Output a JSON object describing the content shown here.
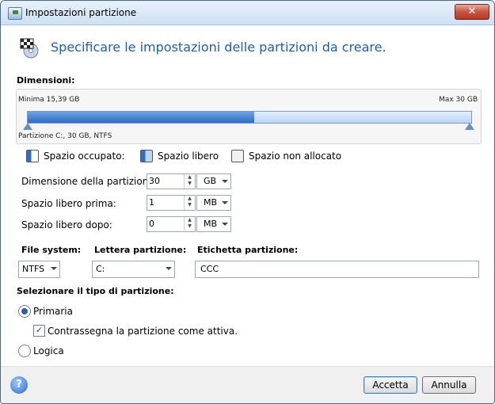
{
  "window": {
    "title": "Impostazioni partizione",
    "close_label": "✕"
  },
  "header": {
    "text": "Specificare le impostazioni delle partizioni da creare."
  },
  "sizes": {
    "label": "Dimensioni:",
    "min": "Minima 15,39 GB",
    "max": "Max 30 GB",
    "partition_info": "Partizione C:, 30 GB, NTFS",
    "used_fraction": 0.51
  },
  "legend": {
    "occupied": "Spazio occupato:",
    "free": "Spazio libero",
    "unallocated": "Spazio non allocato"
  },
  "fields": {
    "partition_size": {
      "label": "Dimensione della partizione:",
      "value": "30",
      "unit": "GB"
    },
    "free_before": {
      "label": "Spazio libero prima:",
      "value": "1",
      "unit": "MB"
    },
    "free_after": {
      "label": "Spazio libero dopo:",
      "value": "0",
      "unit": "MB"
    }
  },
  "filesystem": {
    "label": "File system:",
    "value": "NTFS"
  },
  "letter": {
    "label": "Lettera partizione:",
    "value": "C:"
  },
  "volume_label": {
    "label": "Etichetta partizione:",
    "value": "CCC"
  },
  "partition_type": {
    "label": "Selezionare il tipo di partizione:",
    "primary": "Primaria",
    "active": "Contrassegna la partizione come attiva.",
    "logical": "Logica"
  },
  "footer": {
    "help": "?",
    "ok": "Accetta",
    "cancel": "Annulla"
  },
  "colors": {
    "accent": "#1e5fa8",
    "bar_used": "#2f6ec7",
    "bar_free": "#bcd4f5"
  }
}
